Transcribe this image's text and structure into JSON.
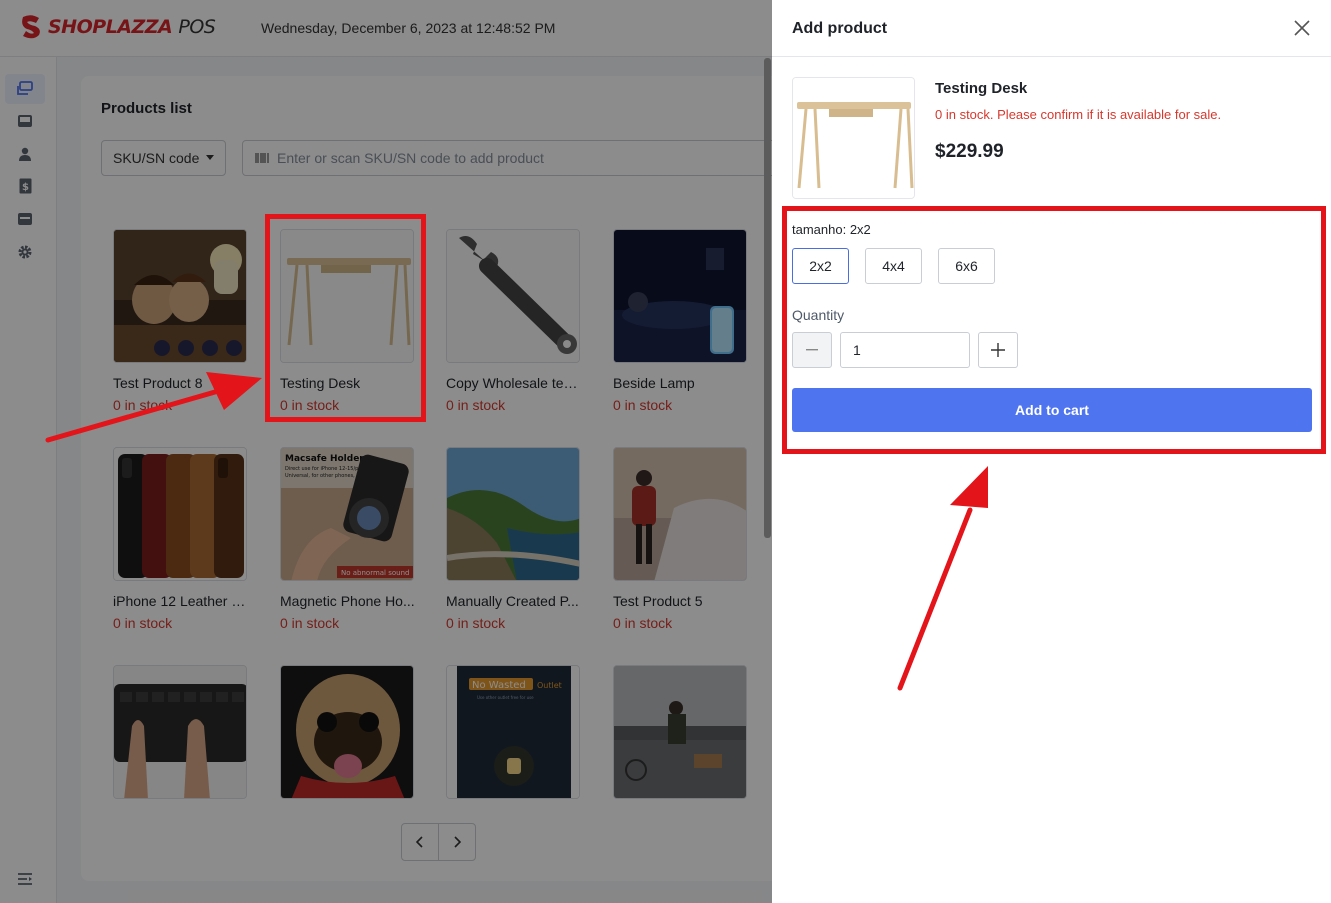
{
  "header": {
    "brand": "SHOPLAZZA",
    "brand_suffix": "POS",
    "datetime": "Wednesday, December 6, 2023 at 12:48:52 PM"
  },
  "colors": {
    "brand": "#d8262d",
    "primary": "#4f74f0",
    "danger": "#d5392e",
    "annotation": "#e3141a"
  },
  "sidebar": {
    "items": [
      {
        "icon": "cards-icon",
        "active": true
      },
      {
        "icon": "inbox-icon",
        "active": false
      },
      {
        "icon": "user-icon",
        "active": false
      },
      {
        "icon": "receipt-icon",
        "active": false
      },
      {
        "icon": "register-icon",
        "active": false
      },
      {
        "icon": "gear-icon",
        "active": false
      }
    ],
    "footer_icon": "menu-expand-icon"
  },
  "products_list": {
    "title": "Products list",
    "filter": {
      "selected": "SKU/SN code"
    },
    "search": {
      "placeholder": "Enter or scan SKU/SN code to add product"
    },
    "products": [
      {
        "name": "Test Product 8",
        "stock": "0 in stock"
      },
      {
        "name": "Testing Desk",
        "stock": "0 in stock"
      },
      {
        "name": "Copy Wholesale tes...",
        "stock": "0 in stock"
      },
      {
        "name": "Beside Lamp",
        "stock": "0 in stock"
      },
      {
        "name": "iPhone 12 Leather C...",
        "stock": "0 in stock"
      },
      {
        "name": "Magnetic Phone Ho...",
        "stock": "0 in stock"
      },
      {
        "name": "Manually Created P...",
        "stock": "0 in stock"
      },
      {
        "name": "Test Product 5",
        "stock": "0 in stock"
      },
      {
        "name": "",
        "stock": ""
      },
      {
        "name": "",
        "stock": ""
      },
      {
        "name": "",
        "stock": ""
      },
      {
        "name": "",
        "stock": ""
      }
    ],
    "image_texts": {
      "magsafe_title": "Macsafe Holder",
      "magsafe_line1": "Direct use for iPhone 12-15/pro/m",
      "magsafe_line2": "Universal, for other phones, too",
      "magsafe_badge": "No abnormal sound",
      "nightlight_badge": "No Wasted",
      "nightlight_outlet": "Outlet",
      "nightlight_sub": "Use other outlet free for use"
    }
  },
  "drawer": {
    "title": "Add product",
    "product": {
      "name": "Testing Desk",
      "warning": "0 in stock. Please confirm if it is available for sale.",
      "price": "$229.99"
    },
    "variant": {
      "label": "tamanho: 2x2",
      "options": [
        "2x2",
        "4x4",
        "6x6"
      ],
      "selected": "2x2"
    },
    "quantity": {
      "label": "Quantity",
      "value": "1"
    },
    "add_to_cart": "Add to cart"
  }
}
